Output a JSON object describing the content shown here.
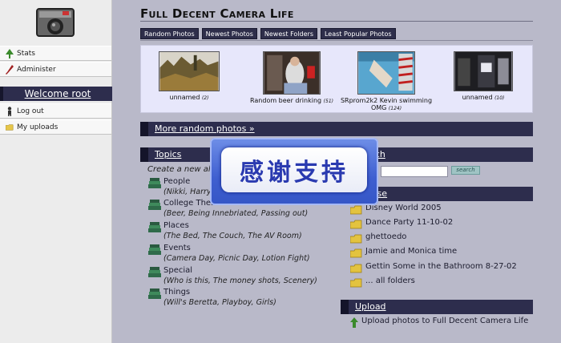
{
  "sidebar": {
    "links_top": [
      {
        "label": "Stats",
        "icon": "tree-icon"
      },
      {
        "label": "Administer",
        "icon": "pen-icon"
      }
    ],
    "welcome": "Welcome root",
    "links_bottom": [
      {
        "label": "Log out",
        "icon": "person-icon"
      },
      {
        "label": "My uploads",
        "icon": "folder-icon"
      }
    ]
  },
  "header": {
    "title": "Full Decent Camera Life",
    "tabs": [
      "Random Photos",
      "Newest Photos",
      "Newest Folders",
      "Least Popular Photos"
    ]
  },
  "photos": [
    {
      "caption": "unnamed",
      "count": "(2)"
    },
    {
      "caption": "Random beer drinking",
      "count": "(51)"
    },
    {
      "caption": "SRprom2k2 Kevin swimming",
      "caption2": "OMG",
      "count": "(124)"
    },
    {
      "caption": "unnamed",
      "count": "(10)"
    }
  ],
  "more_random": "More random photos »",
  "topics": {
    "heading": "Topics",
    "intro": "Create a new album",
    "items": [
      {
        "name": "People",
        "sub": "(Nikki, Harry, Kevin)"
      },
      {
        "name": "College Themes",
        "sub": "(Beer, Being Innebriated, Passing out)"
      },
      {
        "name": "Places",
        "sub": "(The Bed, The Couch, The AV Room)"
      },
      {
        "name": "Events",
        "sub": "(Camera Day, Picnic Day, Lotion Fight)"
      },
      {
        "name": "Special",
        "sub": "(Who is this, The money shots, Scenery)"
      },
      {
        "name": "Things",
        "sub": "(Will's Beretta, Playboy, Girls)"
      }
    ]
  },
  "search": {
    "heading": "Search",
    "value": "",
    "button": "search"
  },
  "browse": {
    "heading": "Browse",
    "folders": [
      "Disney World 2005",
      "Dance Party 11-10-02",
      "ghettoedo",
      "Jamie and Monica time",
      "Gettin Some in the Bathroom 8-27-02",
      "... all folders"
    ]
  },
  "upload": {
    "heading": "Upload",
    "link": "Upload photos to Full Decent Camera Life"
  },
  "overlay": {
    "text": "感谢支持"
  },
  "colors": {
    "background": "#b9b9c9",
    "bar": "#2d2d4d",
    "photo_panel": "#e7e7fb",
    "sidebar": "#ececec"
  }
}
